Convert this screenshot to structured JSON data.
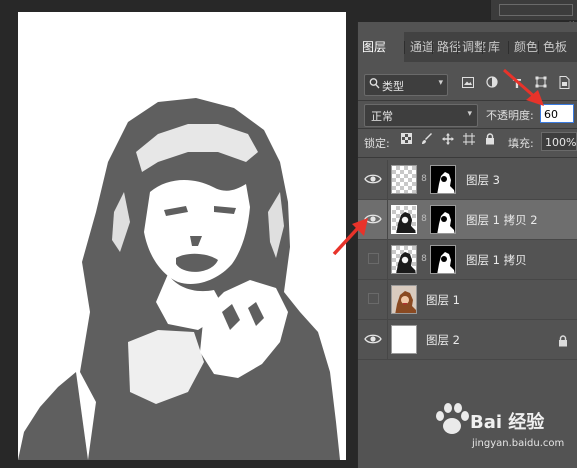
{
  "tabs": [
    {
      "label": "图层",
      "active": true
    },
    {
      "label": "通道",
      "active": false
    },
    {
      "label": "路径",
      "active": false
    },
    {
      "label": "调整",
      "active": false
    },
    {
      "label": "库",
      "active": false
    },
    {
      "label": "颜色",
      "active": false
    },
    {
      "label": "色板",
      "active": false
    }
  ],
  "filter": {
    "label": "类型",
    "icon": "search-icon"
  },
  "filter_icons": [
    "image-filter-icon",
    "adjustment-filter-icon",
    "type-filter-icon",
    "shape-filter-icon",
    "smart-object-filter-icon"
  ],
  "blend_mode": "正常",
  "opacity": {
    "label": "不透明度:",
    "value": "60"
  },
  "lock": {
    "label": "锁定:",
    "icons": [
      "lock-transparent-icon",
      "lock-paint-icon",
      "lock-move-icon",
      "lock-artboard-icon",
      "lock-all-icon"
    ]
  },
  "fill": {
    "label": "填充:",
    "value": "100%"
  },
  "layers": [
    {
      "name": "图层 3",
      "visible": true,
      "selected": false,
      "has_mask": true,
      "thumb": "checker",
      "locked": false
    },
    {
      "name": "图层 1 拷贝 2",
      "visible": true,
      "selected": true,
      "has_mask": true,
      "thumb": "checker-portrait",
      "locked": false
    },
    {
      "name": "图层 1 拷贝",
      "visible": false,
      "selected": false,
      "has_mask": true,
      "thumb": "checker-portrait",
      "locked": false
    },
    {
      "name": "图层 1",
      "visible": false,
      "selected": false,
      "has_mask": false,
      "thumb": "photo",
      "locked": false
    },
    {
      "name": "图层 2",
      "visible": true,
      "selected": false,
      "has_mask": false,
      "thumb": "white",
      "locked": true
    }
  ],
  "watermark": {
    "brand": "Bai 经验",
    "url": "jingyan.baidu.com"
  },
  "colors": {
    "panel": "#535353",
    "selected_row": "#6e6e6e",
    "canvas_bg": "#282828",
    "portrait": "#5f5f5f",
    "arrow": "#e8332a",
    "focus": "#3a7be0"
  }
}
